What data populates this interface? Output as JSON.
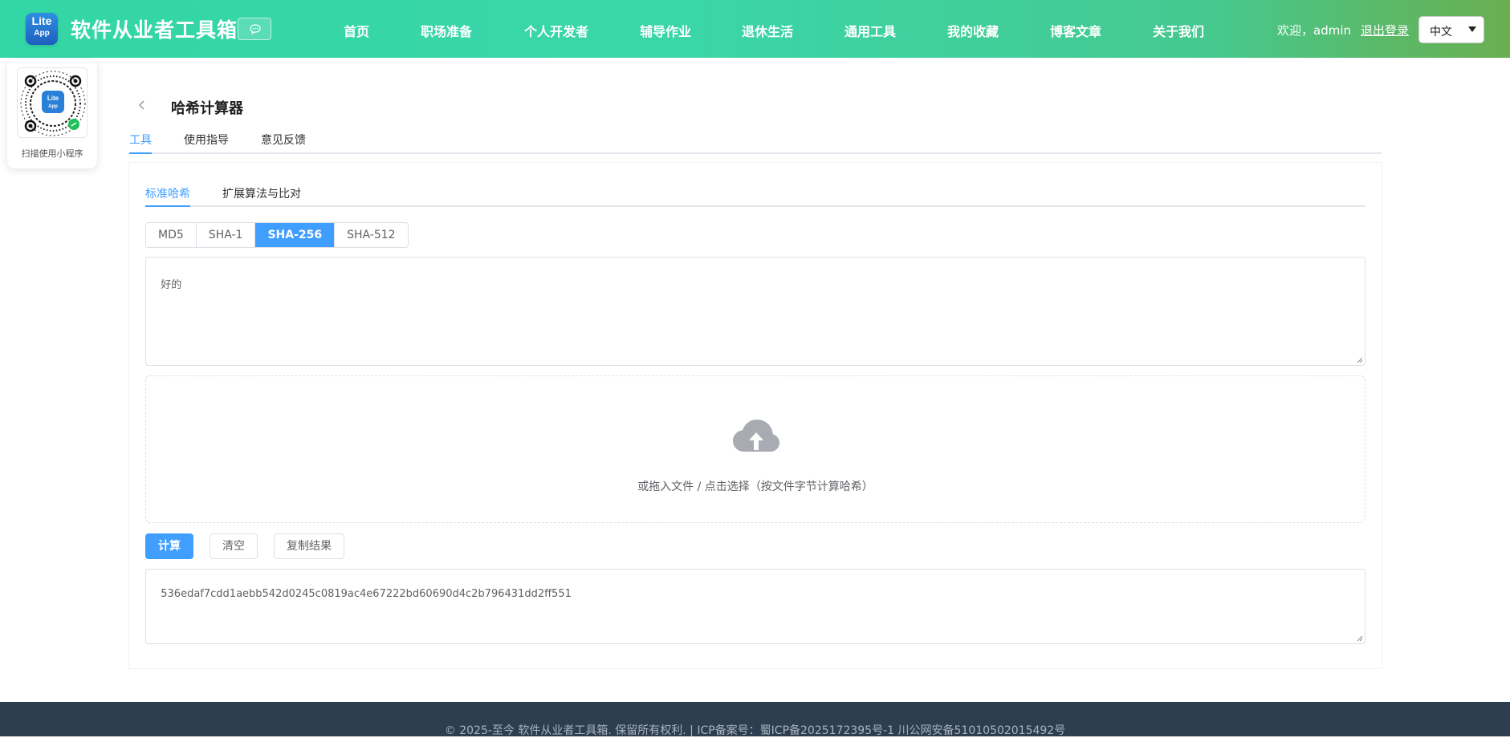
{
  "header": {
    "logo_line1": "Lite",
    "logo_line2": "App",
    "site_title": "软件从业者工具箱",
    "nav": [
      "首页",
      "职场准备",
      "个人开发者",
      "辅导作业",
      "退休生活",
      "通用工具",
      "我的收藏",
      "博客文章",
      "关于我们"
    ],
    "welcome": "欢迎，admin",
    "logout": "退出登录",
    "language": "中文"
  },
  "qr": {
    "caption": "扫描使用小程序"
  },
  "page": {
    "title": "哈希计算器",
    "tabs": [
      "工具",
      "使用指导",
      "意见反馈"
    ],
    "active_tab": "工具"
  },
  "tool": {
    "sub_tabs": [
      "标准哈希",
      "扩展算法与比对"
    ],
    "active_sub_tab": "标准哈希",
    "algorithms": [
      "MD5",
      "SHA-1",
      "SHA-256",
      "SHA-512"
    ],
    "active_algorithm": "SHA-256",
    "input_text": "好的",
    "dropzone_text": "或拖入文件 / 点击选择（按文件字节计算哈希）",
    "buttons": {
      "calculate": "计算",
      "clear": "清空",
      "copy": "复制结果"
    },
    "result": "536edaf7cdd1aebb542d0245c0819ac4e67222bd60690d4c2b796431dd2ff551"
  },
  "footer": {
    "text": "© 2025-至今 软件从业者工具箱. 保留所有权利.   |   ICP备案号：蜀ICP备2025172395号-1    川公网安备51010502015492号"
  },
  "colors": {
    "accent": "#409eff",
    "header_start": "#33d6a6",
    "header_end": "#6aae4f",
    "footer": "#2c3e50"
  }
}
